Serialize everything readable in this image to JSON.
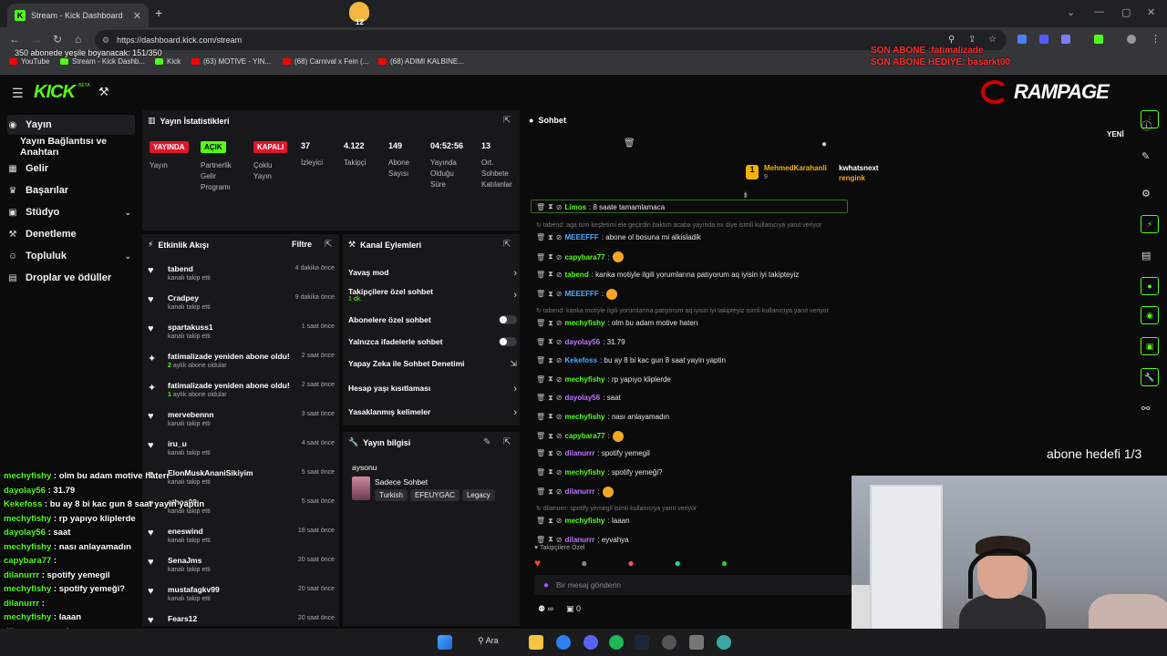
{
  "browser": {
    "tab_title": "Stream - Kick Dashboard",
    "url": "https://dashboard.kick.com/stream",
    "bookmarks": [
      "YouTube",
      "Stream - Kick Dashb...",
      "Kick",
      "(63) MOTIVE - YIN...",
      "(68) Carnival x Fein (...",
      "(68) ADIMI KALBINE..."
    ],
    "ext_badge": "12"
  },
  "overlay": {
    "sub_goal_top": "350 abonede yeşile boyanacak: 151/350",
    "son_abone": "SON ABONE :fatimalizade",
    "son_abone_hediye": "SON ABONE HEDIYE: basarkt00",
    "abone_hedefi": "abone hedefi 1/3",
    "chat": [
      {
        "user": "mechyfishy",
        "msg": " : olm bu adam motive haterı"
      },
      {
        "user": "dayolay56",
        "msg": " : 31.79"
      },
      {
        "user": "Kekefoss",
        "msg": " : bu ay 8 bi kac gun 8 saat yayin yaptin"
      },
      {
        "user": "mechyfishy",
        "msg": " : rp yapıyo kliplerde"
      },
      {
        "user": "dayolay56",
        "msg": " : saat"
      },
      {
        "user": "mechyfishy",
        "msg": " : nası anlayamadın"
      },
      {
        "user": "capybara77",
        "msg": " :"
      },
      {
        "user": "dilanurrr",
        "msg": " : spotify yemegil"
      },
      {
        "user": "mechyfishy",
        "msg": " : spotify yemeği?"
      },
      {
        "user": "dilanurrr",
        "msg": " :"
      },
      {
        "user": "mechyfishy",
        "msg": " : laaan"
      },
      {
        "user": "dilanurrr",
        "msg": " : eyvahya"
      }
    ]
  },
  "app": {
    "logo": "KICK",
    "beta": "BETA",
    "brand_logo": "RAMPAGE"
  },
  "sidebar": [
    {
      "icon": "broadcast-icon",
      "glyph": "((•))",
      "label": "Yayın"
    },
    {
      "icon": "",
      "glyph": "",
      "label": "Yayın Bağlantısı ve Anahtarı"
    },
    {
      "icon": "wallet-icon",
      "glyph": "▦",
      "label": "Gelir"
    },
    {
      "icon": "trophy-icon",
      "glyph": "🏆",
      "label": "Başarılar"
    },
    {
      "icon": "studio-icon",
      "glyph": "▣",
      "label": "Stüdyo"
    },
    {
      "icon": "hammer-icon",
      "glyph": "🔨",
      "label": "Denetleme"
    },
    {
      "icon": "community-icon",
      "glyph": "👥",
      "label": "Topluluk"
    },
    {
      "icon": "gift-icon",
      "glyph": "▤",
      "label": "Droplar ve ödüller"
    }
  ],
  "stats": {
    "title": "Yayın İstatistikleri",
    "yayin_badge": "YAYINDA",
    "yayin_label": "Yayın",
    "partner_badge": "AÇIK",
    "partner_label": "Partnerlik Gelir Programı",
    "coklu_badge": "KAPALI",
    "coklu_label": "Çoklu Yayın",
    "items": [
      {
        "value": "37",
        "label": "İzleyici"
      },
      {
        "value": "4.122",
        "label": "Takipçi"
      },
      {
        "value": "149",
        "label": "Abone Sayısı"
      },
      {
        "value": "04:52:56",
        "label": "Yayında Olduğu Süre"
      },
      {
        "value": "13",
        "label": "Ort. Sohbete Katılanlar"
      }
    ]
  },
  "activity": {
    "title": "Etkinlik Akışı",
    "filter": "Filtre",
    "items": [
      {
        "type": "follow",
        "name": "tabend",
        "sub": "kanalı takip etti",
        "time": "4 dakika önce"
      },
      {
        "type": "follow",
        "name": "Cradpey",
        "sub": "kanalı takip etti",
        "time": "9 dakika önce"
      },
      {
        "type": "follow",
        "name": "spartakuss1",
        "sub": "kanalı takip etti",
        "time": "1 saat önce"
      },
      {
        "type": "sub",
        "name": "fatimalizade yeniden abone oldu!",
        "sub_num": "2",
        "sub": " aylık abone oldular",
        "time": "2 saat önce"
      },
      {
        "type": "sub",
        "name": "fatimalizade yeniden abone oldu!",
        "sub_num": "1",
        "sub": " aylık abone oldular",
        "time": "2 saat önce"
      },
      {
        "type": "follow",
        "name": "mervebennn",
        "sub": "kanalı takip etti",
        "time": "3 saat önce"
      },
      {
        "type": "follow",
        "name": "iru_u",
        "sub": "kanalı takip etti",
        "time": "4 saat önce"
      },
      {
        "type": "follow",
        "name": "ElonMuskAnaniSikiyim",
        "sub": "kanalı takip etti",
        "time": "5 saat önce"
      },
      {
        "type": "follow",
        "name": "athos09",
        "sub": "kanalı takip etti",
        "time": "5 saat önce"
      },
      {
        "type": "follow",
        "name": "eneswind",
        "sub": "kanalı takip etti",
        "time": "18 saat önce"
      },
      {
        "type": "follow",
        "name": "SenaJms",
        "sub": "kanalı takip etti",
        "time": "20 saat önce"
      },
      {
        "type": "follow",
        "name": "mustafagkv99",
        "sub": "kanalı takip etti",
        "time": "20 saat önce"
      },
      {
        "type": "follow",
        "name": "Fears12",
        "sub": "",
        "time": "20 saat önce"
      }
    ]
  },
  "actions": {
    "title": "Kanal Eylemleri",
    "items": [
      {
        "label": "Yavaş mod",
        "sub": "",
        "control": "chevron"
      },
      {
        "label": "Takipçilere özel sohbet",
        "sub": "1 dk.",
        "control": "chevron"
      },
      {
        "label": "Abonelere özel sohbet",
        "sub": "",
        "control": "toggle"
      },
      {
        "label": "Yalnızca ifadelerle sohbet",
        "sub": "",
        "control": "toggle"
      },
      {
        "label": "Yapay Zeka ile Sohbet Denetimi",
        "sub": "",
        "control": "external"
      },
      {
        "label": "Hesap yaşı kısıtlaması",
        "sub": "",
        "control": "chevron"
      },
      {
        "label": "Yasaklanmış kelimeler",
        "sub": "",
        "control": "chevron"
      }
    ]
  },
  "stream_info": {
    "title": "Yayın bilgisi",
    "stream_title": "aysonu",
    "category": "Sadece Sohbet",
    "tags": [
      "Turkish",
      "EFEUYGAC",
      "Legacy"
    ]
  },
  "chat": {
    "title": "Sohbet",
    "pinned_user1": "MehmedKarahanli",
    "pinned_count1": "9",
    "pinned_user2": "kwhatsnext",
    "pinned_count2": "1",
    "pinned_user3": "rengink",
    "pinned_count3": "1",
    "new_label": "YENİ",
    "followers_only": "Takipçilere Özel",
    "input_placeholder": "Bir mesaj gönderin",
    "footer_count": "0",
    "footer_infinity": "∞",
    "messages": [
      {
        "kind": "msg",
        "user": "Limos",
        "color": "#53fc18",
        "text": ": 8 saate tamamlamaca"
      },
      {
        "kind": "reply",
        "text": "↻ tabend: aga tüm keşfetimi ele geçirdin baktım acaba yayında mı diye isimli kullanıcıya yanıt veriyor"
      },
      {
        "kind": "msg",
        "user": "MEEEFFF",
        "color": "#4ea7ff",
        "text": ": abone ol bosuna mi alkisladik"
      },
      {
        "kind": "msg",
        "user": "capybara77",
        "color": "#53fc18",
        "text": ":",
        "emoji": true
      },
      {
        "kind": "msg",
        "user": "tabend",
        "color": "#53fc18",
        "text": ": kanka motiyle ilgili yorumlarına patıyorum aq iyisin iyi takipteyiz"
      },
      {
        "kind": "msg",
        "user": "MEEEFFF",
        "color": "#4ea7ff",
        "text": ":",
        "emoji": true
      },
      {
        "kind": "reply",
        "text": "↻ tabend: kanka motiyle ilgili yorumlarına patıyorum aq iyisin iyi takipteyiz isimli kullanıcıya yanıt veriyor"
      },
      {
        "kind": "msg",
        "user": "mechyfishy",
        "color": "#53fc18",
        "text": ": olm bu adam motive haterı"
      },
      {
        "kind": "msg",
        "user": "dayolay56",
        "color": "#c174ff",
        "text": ": 31.79"
      },
      {
        "kind": "msg",
        "user": "Kekefoss",
        "color": "#4ea7ff",
        "text": ": bu ay 8 bi kac gun 8 saat yayin yaptin"
      },
      {
        "kind": "msg",
        "user": "mechyfishy",
        "color": "#53fc18",
        "text": ": rp yapıyo kliplerde"
      },
      {
        "kind": "msg",
        "user": "dayolay56",
        "color": "#c174ff",
        "text": ": saat"
      },
      {
        "kind": "msg",
        "user": "mechyfishy",
        "color": "#53fc18",
        "text": ": nası anlayamadın"
      },
      {
        "kind": "msg",
        "user": "capybara77",
        "color": "#53fc18",
        "text": ":",
        "emoji": true
      },
      {
        "kind": "msg",
        "user": "dilanurrr",
        "color": "#c174ff",
        "text": ": spotify yemegil"
      },
      {
        "kind": "msg",
        "user": "mechyfishy",
        "color": "#53fc18",
        "text": ": spotify yemeği?"
      },
      {
        "kind": "msg",
        "user": "dilanurrr",
        "color": "#c174ff",
        "text": ":",
        "emoji": true
      },
      {
        "kind": "reply",
        "text": "↻ dilanurrr: spotify yemegil isimli kullanıcıya yanıt veriyor"
      },
      {
        "kind": "msg",
        "user": "mechyfishy",
        "color": "#53fc18",
        "text": ": laaan"
      },
      {
        "kind": "msg",
        "user": "dilanurrr",
        "color": "#c174ff",
        "text": ": eyvahya"
      }
    ]
  },
  "taskbar": {
    "search": "Ara"
  },
  "colors": {
    "kick_green": "#53fc18",
    "live_red": "#e0162b",
    "panel_bg": "#18181b"
  }
}
